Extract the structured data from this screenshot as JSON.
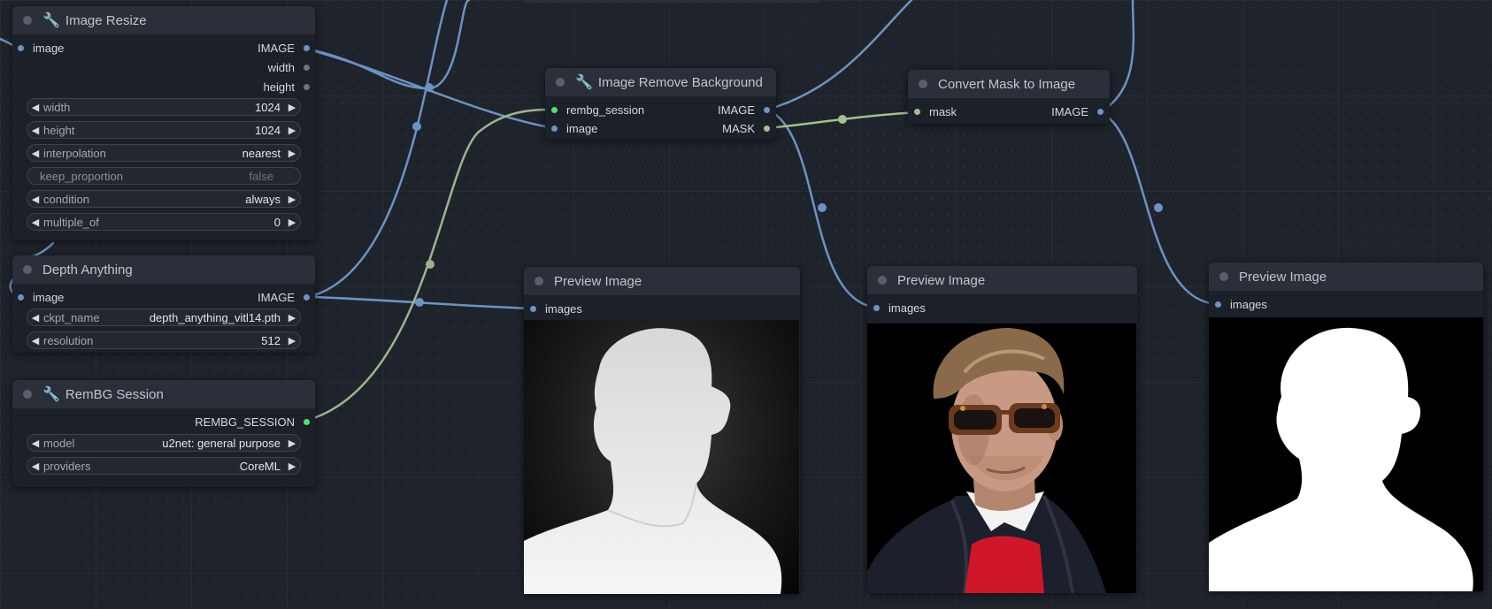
{
  "nodes": {
    "image_resize": {
      "title": "Image Resize",
      "input": "image",
      "outputs": [
        "IMAGE",
        "width",
        "height"
      ],
      "widgets": [
        {
          "label": "width",
          "value": "1024"
        },
        {
          "label": "height",
          "value": "1024"
        },
        {
          "label": "interpolation",
          "value": "nearest"
        },
        {
          "label": "keep_proportion",
          "value": "false"
        },
        {
          "label": "condition",
          "value": "always"
        },
        {
          "label": "multiple_of",
          "value": "0"
        }
      ]
    },
    "depth_anything": {
      "title": "Depth Anything",
      "input": "image",
      "output": "IMAGE",
      "widgets": [
        {
          "label": "ckpt_name",
          "value": "depth_anything_vitl14.pth"
        },
        {
          "label": "resolution",
          "value": "512"
        }
      ]
    },
    "rembg_session": {
      "title": "RemBG Session",
      "output": "REMBG_SESSION",
      "widgets": [
        {
          "label": "model",
          "value": "u2net: general purpose"
        },
        {
          "label": "providers",
          "value": "CoreML"
        }
      ]
    },
    "remove_bg": {
      "title": "Image Remove Background",
      "inputs": [
        "rembg_session",
        "image"
      ],
      "outputs": [
        "IMAGE",
        "MASK"
      ]
    },
    "mask_to_image": {
      "title": "Convert Mask to Image",
      "input": "mask",
      "output": "IMAGE"
    },
    "preview_1": {
      "title": "Preview Image",
      "input": "images"
    },
    "preview_2": {
      "title": "Preview Image",
      "input": "images"
    },
    "preview_3": {
      "title": "Preview Image",
      "input": "images"
    }
  },
  "colors": {
    "image_link": "#6b93c4",
    "mask_link": "#a3c08a",
    "session_link": "#9fb290",
    "session_slot": "#52e06a"
  },
  "icons": {
    "node_icon": "wrench-icon",
    "widget_arrows": [
      "arrow-left-icon",
      "arrow-right-icon"
    ]
  }
}
